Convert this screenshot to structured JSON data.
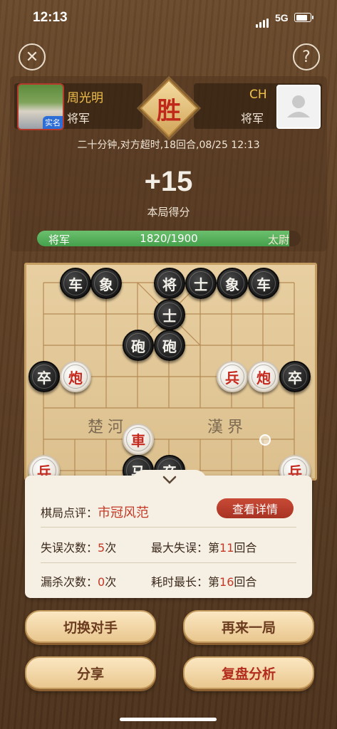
{
  "status_bar": {
    "time": "12:13",
    "network": "5G"
  },
  "header": {
    "close_icon": "close-icon",
    "help_icon": "help-icon",
    "help_glyph": "?"
  },
  "players": {
    "left": {
      "name": "周光明",
      "rank": "将军",
      "badge": "实名"
    },
    "right": {
      "name": "CH",
      "rank": "将军"
    },
    "result": "胜",
    "meta": "二十分钟,对方超时,18回合,08/25 12:13"
  },
  "score": {
    "value": "+15",
    "label": "本局得分"
  },
  "rank_progress": {
    "current_rank": "将军",
    "next_rank": "太尉",
    "text": "1820/1900",
    "fraction": 0.958
  },
  "board": {
    "river_left": "楚河",
    "river_right": "漢界",
    "pieces": [
      {
        "text": "车",
        "side": "black"
      },
      {
        "text": "象",
        "side": "black"
      },
      {
        "text": "将",
        "side": "black"
      },
      {
        "text": "士",
        "side": "black"
      },
      {
        "text": "象",
        "side": "black"
      },
      {
        "text": "车",
        "side": "black"
      },
      {
        "text": "士",
        "side": "black"
      },
      {
        "text": "砲",
        "side": "black"
      },
      {
        "text": "砲",
        "side": "black"
      },
      {
        "text": "卒",
        "side": "black"
      },
      {
        "text": "炮",
        "side": "red"
      },
      {
        "text": "兵",
        "side": "red"
      },
      {
        "text": "炮",
        "side": "red"
      },
      {
        "text": "卒",
        "side": "black"
      },
      {
        "text": "車",
        "side": "red"
      },
      {
        "text": "马",
        "side": "black"
      },
      {
        "text": "卒",
        "side": "black"
      },
      {
        "text": "兵",
        "side": "red"
      },
      {
        "text": "兵",
        "side": "red"
      }
    ]
  },
  "review": {
    "collapse_icon": "chevron-down-icon",
    "comment_label": "棋局点评：",
    "comment_value": "市冠风范",
    "details_button": "查看详情",
    "mistakes_label": "失误次数：",
    "mistakes_value": "5",
    "mistakes_unit": "次",
    "max_mistake_label": "最大失误：第",
    "max_mistake_value": "11",
    "max_mistake_unit": "回合",
    "missed_label": "漏杀次数：",
    "missed_value": "0",
    "missed_unit": "次",
    "longest_label": "耗时最长：第",
    "longest_value": "16",
    "longest_unit": "回合"
  },
  "actions": {
    "switch_opponent": "切换对手",
    "play_again": "再来一局",
    "share": "分享",
    "replay_analysis": "复盘分析"
  }
}
